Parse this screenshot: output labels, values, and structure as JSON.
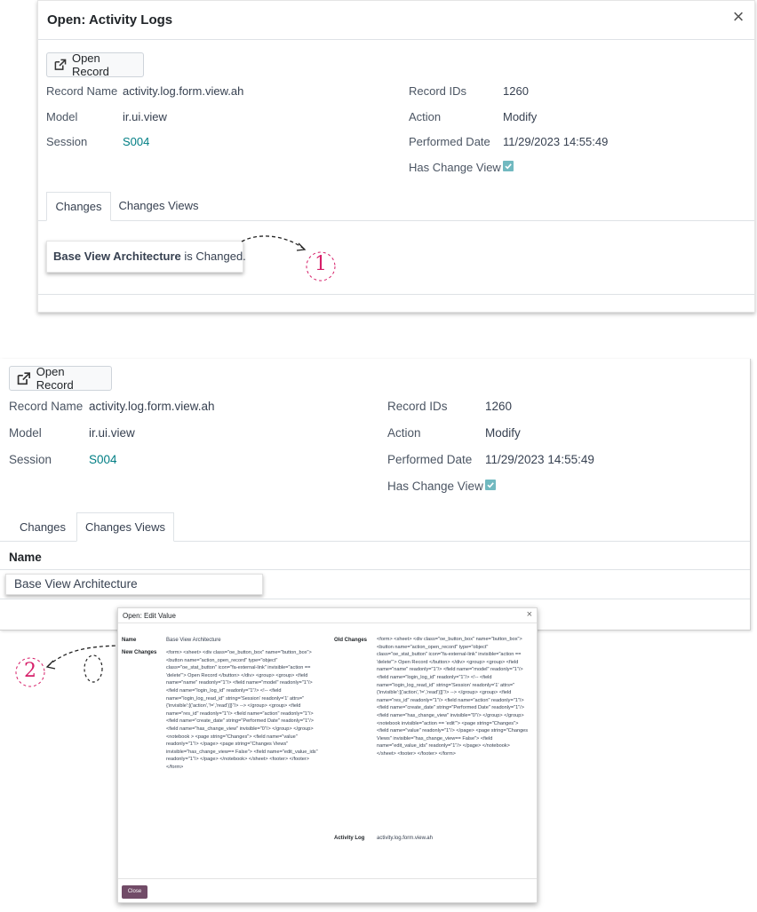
{
  "panel1": {
    "title": "Open: Activity Logs",
    "close_icon": "×",
    "open_record_label": "Open Record",
    "fields": {
      "record_name_label": "Record Name",
      "record_name_value": "activity.log.form.view.ah",
      "model_label": "Model",
      "model_value": "ir.ui.view",
      "session_label": "Session",
      "session_value": "S004",
      "record_ids_label": "Record IDs",
      "record_ids_value": "1260",
      "action_label": "Action",
      "action_value": "Modify",
      "performed_date_label": "Performed Date",
      "performed_date_value": "11/29/2023 14:55:49",
      "has_change_view_label": "Has Change View",
      "has_change_view_value": true
    },
    "tabs": [
      "Changes",
      "Changes Views"
    ],
    "active_tab": "Changes",
    "changed_bold": "Base View Architecture",
    "changed_rest": " is Changed."
  },
  "panel2": {
    "open_record_label": "Open Record",
    "fields": {
      "record_name_label": "Record Name",
      "record_name_value": "activity.log.form.view.ah",
      "model_label": "Model",
      "model_value": "ir.ui.view",
      "session_label": "Session",
      "session_value": "S004",
      "record_ids_label": "Record IDs",
      "record_ids_value": "1260",
      "action_label": "Action",
      "action_value": "Modify",
      "performed_date_label": "Performed Date",
      "performed_date_value": "11/29/2023 14:55:49",
      "has_change_view_label": "Has Change View",
      "has_change_view_value": true
    },
    "tabs": [
      "Changes",
      "Changes Views"
    ],
    "active_tab": "Changes Views",
    "list_header": "Name",
    "list_rows": [
      "Base View Architecture"
    ]
  },
  "dialog": {
    "title": "Open: Edit Value",
    "close_icon": "×",
    "name_label": "Name",
    "name_value": "Base View Architecture",
    "new_changes_label": "New Changes",
    "new_changes_value": "<form> <sheet> <div class=\"oe_button_box\" name=\"button_box\"> <button name=\"action_open_record\" type=\"object\" class=\"oe_stat_button\" icon=\"fa-external-link\" invisible=\"action == 'delete'\"> Open Record </button> </div> <group> <group> <field name=\"name\" readonly=\"1\"/> <field name=\"model\" readonly=\"1\"/> <field name=\"login_log_id\" readonly=\"1\"/> <!-- <field name=\"login_log_read_id\" string='Session' readonly='1' attrs=\"{'invisible':[('action','!=','read')]}\"/> --> </group> <group> <field name=\"res_id\" readonly=\"1\"/> <field name=\"action\" readonly=\"1\"/> <field name=\"create_date\" string=\"Performed Date\" readonly=\"1\"/> <field name=\"has_change_view\" invisible=\"0\"/> </group> </group> <notebook > <page string=\"Changes\"> <field name=\"value\" readonly=\"1\"/> </page> <page string=\"Changes Views\" invisible=\"has_change_view== False\"> <field name=\"edit_value_ids\" readonly=\"1\"/> </page> </notebook> </sheet> <footer> </footer> </form>",
    "old_changes_label": "Old Changes",
    "old_changes_value": "<form> <sheet> <div class=\"oe_button_box\" name=\"button_box\"> <button name=\"action_open_record\" type=\"object\" class=\"oe_stat_button\" icon=\"fa-external-link\" invisible=\"action == 'delete'\"> Open Record </button> </div> <group> <group> <field name=\"name\" readonly=\"1\"/> <field name=\"model\" readonly=\"1\"/> <field name=\"login_log_id\" readonly=\"1\"/> <!-- <field name=\"login_log_read_id\" string='Session' readonly='1' attrs=\"{'invisible':[('action','!=','read')]}\"/> --> </group> <group> <field name=\"res_id\" readonly=\"1\"/> <field name=\"action\" readonly=\"1\"/> <field name=\"create_date\" string=\"Performed Date\" readonly=\"1\"/> <field name=\"has_change_view\" invisible=\"0\"/> </group> </group> <notebook invisible=\"action == 'edit'\"> <page string=\"Changes\"> <field name=\"value\" readonly=\"1\"/> </page> <page string=\"Changes Views\" invisible=\"has_change_view== False\"> <field name=\"edit_value_ids\" readonly=\"1\"/> </page> </notebook> </sheet> <footer> </footer> </form>",
    "activity_log_label": "Activity Log",
    "activity_log_value": "activity.log.form.view.ah",
    "close_button_label": "Close"
  },
  "annotations": [
    "1",
    "2"
  ],
  "colors": {
    "link": "#017e84",
    "primary_button": "#714b67",
    "checkbox": "#71b9c0",
    "annotation": "#d61f69"
  }
}
